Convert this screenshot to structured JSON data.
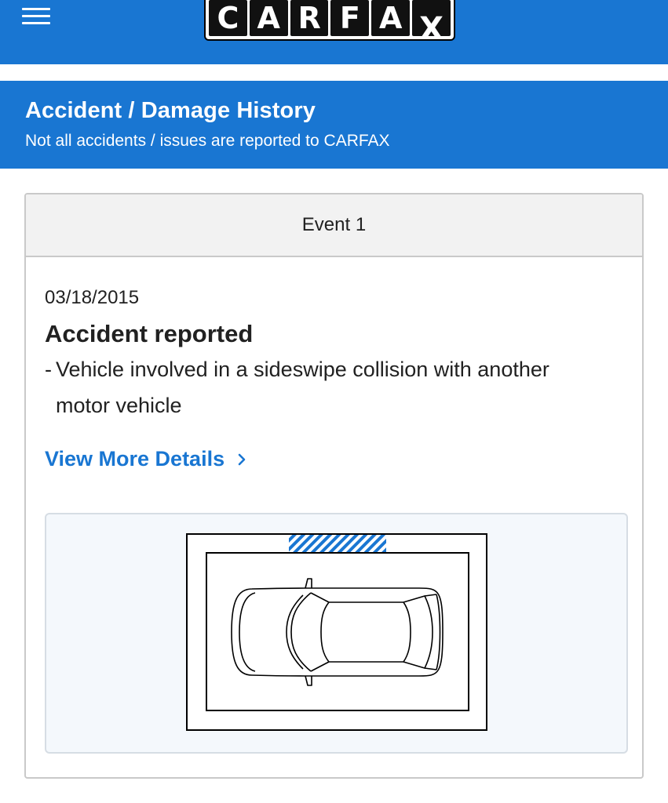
{
  "header": {
    "logo_letters": [
      "C",
      "A",
      "R",
      "F",
      "A",
      "X"
    ],
    "logo_text": "CARFAX",
    "menu_icon": "hamburger-menu-icon",
    "brand_color": "#1976d2"
  },
  "section": {
    "title": "Accident / Damage History",
    "subtitle": "Not all accidents / issues are reported to CARFAX"
  },
  "event": {
    "heading": "Event 1",
    "date": "03/18/2015",
    "type": "Accident reported",
    "detail_bullet": "-",
    "detail": "Vehicle involved in a sideswipe collision with another motor vehicle",
    "link_label": "View More Details",
    "link_icon": "chevron-right-icon",
    "damage_area": "front",
    "damage_icon": "hatched-damage-marker",
    "vehicle_icon": "car-top-view-icon"
  }
}
